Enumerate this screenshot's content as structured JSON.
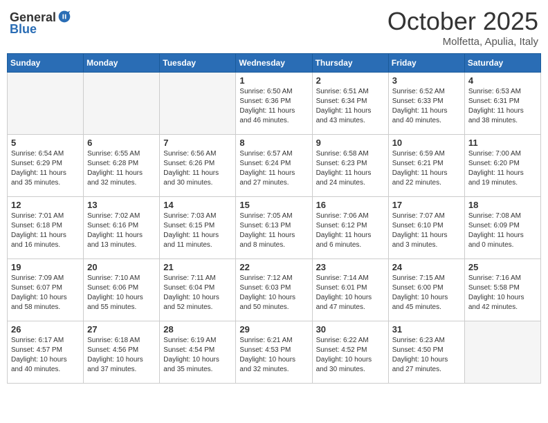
{
  "header": {
    "logo_general": "General",
    "logo_blue": "Blue",
    "month": "October 2025",
    "location": "Molfetta, Apulia, Italy"
  },
  "weekdays": [
    "Sunday",
    "Monday",
    "Tuesday",
    "Wednesday",
    "Thursday",
    "Friday",
    "Saturday"
  ],
  "weeks": [
    [
      {
        "day": "",
        "info": ""
      },
      {
        "day": "",
        "info": ""
      },
      {
        "day": "",
        "info": ""
      },
      {
        "day": "1",
        "info": "Sunrise: 6:50 AM\nSunset: 6:36 PM\nDaylight: 11 hours\nand 46 minutes."
      },
      {
        "day": "2",
        "info": "Sunrise: 6:51 AM\nSunset: 6:34 PM\nDaylight: 11 hours\nand 43 minutes."
      },
      {
        "day": "3",
        "info": "Sunrise: 6:52 AM\nSunset: 6:33 PM\nDaylight: 11 hours\nand 40 minutes."
      },
      {
        "day": "4",
        "info": "Sunrise: 6:53 AM\nSunset: 6:31 PM\nDaylight: 11 hours\nand 38 minutes."
      }
    ],
    [
      {
        "day": "5",
        "info": "Sunrise: 6:54 AM\nSunset: 6:29 PM\nDaylight: 11 hours\nand 35 minutes."
      },
      {
        "day": "6",
        "info": "Sunrise: 6:55 AM\nSunset: 6:28 PM\nDaylight: 11 hours\nand 32 minutes."
      },
      {
        "day": "7",
        "info": "Sunrise: 6:56 AM\nSunset: 6:26 PM\nDaylight: 11 hours\nand 30 minutes."
      },
      {
        "day": "8",
        "info": "Sunrise: 6:57 AM\nSunset: 6:24 PM\nDaylight: 11 hours\nand 27 minutes."
      },
      {
        "day": "9",
        "info": "Sunrise: 6:58 AM\nSunset: 6:23 PM\nDaylight: 11 hours\nand 24 minutes."
      },
      {
        "day": "10",
        "info": "Sunrise: 6:59 AM\nSunset: 6:21 PM\nDaylight: 11 hours\nand 22 minutes."
      },
      {
        "day": "11",
        "info": "Sunrise: 7:00 AM\nSunset: 6:20 PM\nDaylight: 11 hours\nand 19 minutes."
      }
    ],
    [
      {
        "day": "12",
        "info": "Sunrise: 7:01 AM\nSunset: 6:18 PM\nDaylight: 11 hours\nand 16 minutes."
      },
      {
        "day": "13",
        "info": "Sunrise: 7:02 AM\nSunset: 6:16 PM\nDaylight: 11 hours\nand 13 minutes."
      },
      {
        "day": "14",
        "info": "Sunrise: 7:03 AM\nSunset: 6:15 PM\nDaylight: 11 hours\nand 11 minutes."
      },
      {
        "day": "15",
        "info": "Sunrise: 7:05 AM\nSunset: 6:13 PM\nDaylight: 11 hours\nand 8 minutes."
      },
      {
        "day": "16",
        "info": "Sunrise: 7:06 AM\nSunset: 6:12 PM\nDaylight: 11 hours\nand 6 minutes."
      },
      {
        "day": "17",
        "info": "Sunrise: 7:07 AM\nSunset: 6:10 PM\nDaylight: 11 hours\nand 3 minutes."
      },
      {
        "day": "18",
        "info": "Sunrise: 7:08 AM\nSunset: 6:09 PM\nDaylight: 11 hours\nand 0 minutes."
      }
    ],
    [
      {
        "day": "19",
        "info": "Sunrise: 7:09 AM\nSunset: 6:07 PM\nDaylight: 10 hours\nand 58 minutes."
      },
      {
        "day": "20",
        "info": "Sunrise: 7:10 AM\nSunset: 6:06 PM\nDaylight: 10 hours\nand 55 minutes."
      },
      {
        "day": "21",
        "info": "Sunrise: 7:11 AM\nSunset: 6:04 PM\nDaylight: 10 hours\nand 52 minutes."
      },
      {
        "day": "22",
        "info": "Sunrise: 7:12 AM\nSunset: 6:03 PM\nDaylight: 10 hours\nand 50 minutes."
      },
      {
        "day": "23",
        "info": "Sunrise: 7:14 AM\nSunset: 6:01 PM\nDaylight: 10 hours\nand 47 minutes."
      },
      {
        "day": "24",
        "info": "Sunrise: 7:15 AM\nSunset: 6:00 PM\nDaylight: 10 hours\nand 45 minutes."
      },
      {
        "day": "25",
        "info": "Sunrise: 7:16 AM\nSunset: 5:58 PM\nDaylight: 10 hours\nand 42 minutes."
      }
    ],
    [
      {
        "day": "26",
        "info": "Sunrise: 6:17 AM\nSunset: 4:57 PM\nDaylight: 10 hours\nand 40 minutes."
      },
      {
        "day": "27",
        "info": "Sunrise: 6:18 AM\nSunset: 4:56 PM\nDaylight: 10 hours\nand 37 minutes."
      },
      {
        "day": "28",
        "info": "Sunrise: 6:19 AM\nSunset: 4:54 PM\nDaylight: 10 hours\nand 35 minutes."
      },
      {
        "day": "29",
        "info": "Sunrise: 6:21 AM\nSunset: 4:53 PM\nDaylight: 10 hours\nand 32 minutes."
      },
      {
        "day": "30",
        "info": "Sunrise: 6:22 AM\nSunset: 4:52 PM\nDaylight: 10 hours\nand 30 minutes."
      },
      {
        "day": "31",
        "info": "Sunrise: 6:23 AM\nSunset: 4:50 PM\nDaylight: 10 hours\nand 27 minutes."
      },
      {
        "day": "",
        "info": ""
      }
    ]
  ]
}
